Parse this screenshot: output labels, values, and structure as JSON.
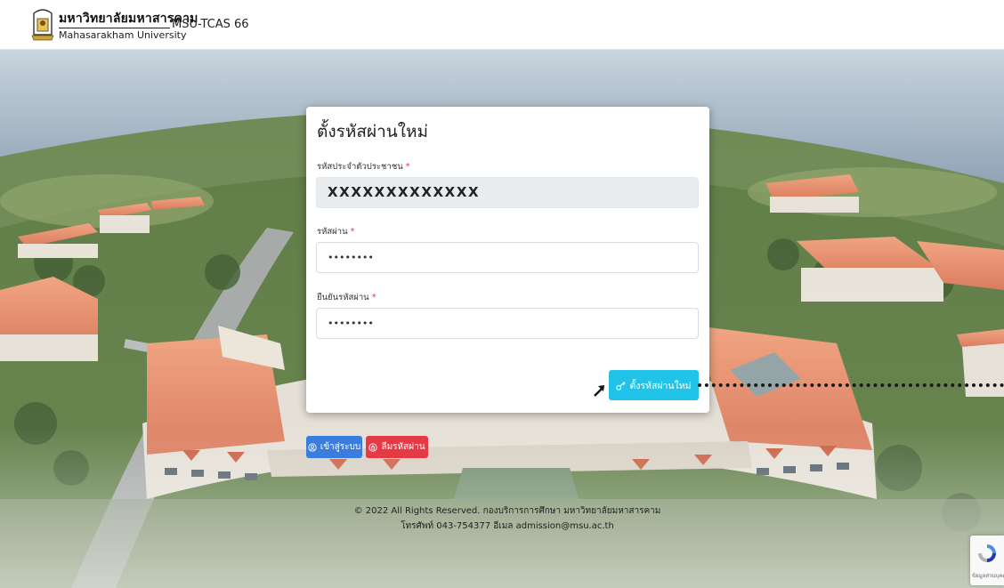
{
  "header": {
    "university_thai": "มหาวิทยาลัยมหาสารคาม",
    "university_english": "Mahasarakham University",
    "system_name": "MSU-TCAS 66"
  },
  "form": {
    "title": "ตั้งรหัสผ่านใหม่",
    "citizen_id_label": "รหัสประจำตัวประชาชน",
    "citizen_id_value": "XXXXXXXXXXXXX",
    "password_label": "รหัสผ่าน",
    "password_value": "••••••••",
    "confirm_password_label": "ยืนยันรหัสผ่าน",
    "confirm_password_value": "••••••••",
    "required_mark": "*",
    "submit_label": "ตั้งรหัสผ่านใหม่",
    "submit_icon": "key-icon"
  },
  "actions": {
    "login_label": "เข้าสู่ระบบ",
    "login_icon": "user-circle-icon",
    "forgot_label": "ลืมรหัสผ่าน",
    "forgot_icon": "lock-icon"
  },
  "footer": {
    "copyright": "© 2022 All Rights Reserved. กองบริการการศึกษา มหาวิทยาลัยมหาสารคาม",
    "contact": "โทรศัพท์ 043-754377 อีเมล admission@msu.ac.th"
  },
  "recaptcha": {
    "text": "ข้อมูลส่วนบุคคล - ข้อกำหนด"
  },
  "colors": {
    "submit_button": "#22c3e8",
    "login_button": "#3b7dde",
    "forgot_button": "#e53945",
    "required": "#dc3545"
  }
}
